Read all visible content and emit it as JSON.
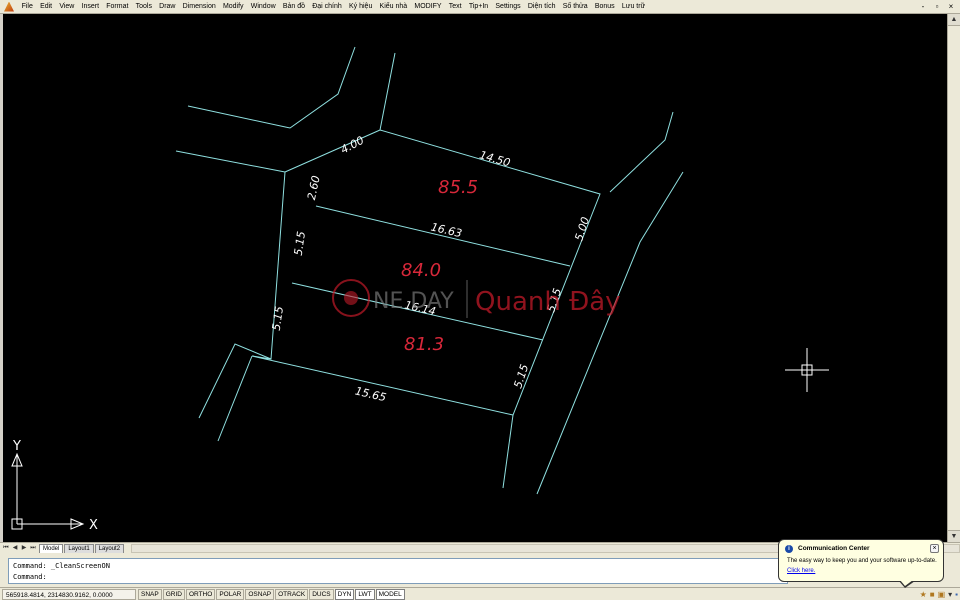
{
  "menu": {
    "items": [
      "File",
      "Edit",
      "View",
      "Insert",
      "Format",
      "Tools",
      "Draw",
      "Dimension",
      "Modify",
      "Window",
      "Bản đồ",
      "Đại chính",
      "Ký hiệu",
      "Kiểu nhà",
      "MODIFY",
      "Text",
      "Tip+In",
      "Settings",
      "Diện tích",
      "Số thửa",
      "Bonus",
      "Lưu trữ"
    ],
    "window_buttons": [
      "-",
      "▫",
      "×"
    ]
  },
  "drawing": {
    "dimensions": {
      "d_4_00": "4.00",
      "d_14_50": "14.50",
      "d_2_60": "2.60",
      "d_5_00": "5.00",
      "d_16_63": "16.63",
      "d_5_15_left_top": "5.15",
      "d_5_15_left_bottom": "5.15",
      "d_5_15_right_mid": "5.15",
      "d_5_15_right_bottom": "5.15",
      "d_16_14": "16.14",
      "d_15_65": "15.65"
    },
    "areas": {
      "top": "85.5",
      "middle": "84.0",
      "bottom": "81.3"
    },
    "colors": {
      "lines": "#8fe0e0",
      "area_text": "#d8283a",
      "background": "#000000"
    }
  },
  "watermark": {
    "brand_a": "NE DAY",
    "brand_b": "Quanh Đây"
  },
  "ucs": {
    "x_label": "X",
    "y_label": "Y"
  },
  "tabs": {
    "nav": [
      "⏮",
      "◀",
      "▶",
      "⏭"
    ],
    "items": [
      "Model",
      "Layout1",
      "Layout2"
    ],
    "active": "Model"
  },
  "command": {
    "line1": "Command: _CleanScreenON",
    "line2": "Command:"
  },
  "status": {
    "coords": "565918.4814, 2314830.9162, 0.0000",
    "buttons": [
      {
        "label": "SNAP",
        "on": false
      },
      {
        "label": "GRID",
        "on": false
      },
      {
        "label": "ORTHO",
        "on": false
      },
      {
        "label": "POLAR",
        "on": false
      },
      {
        "label": "OSNAP",
        "on": false
      },
      {
        "label": "OTRACK",
        "on": false
      },
      {
        "label": "DUCS",
        "on": false
      },
      {
        "label": "DYN",
        "on": true
      },
      {
        "label": "LWT",
        "on": true
      },
      {
        "label": "MODEL",
        "on": true
      }
    ]
  },
  "comm_center": {
    "title": "Communication Center",
    "message": "The easy way to keep you and your software up-to-date.",
    "link": "Click here."
  }
}
